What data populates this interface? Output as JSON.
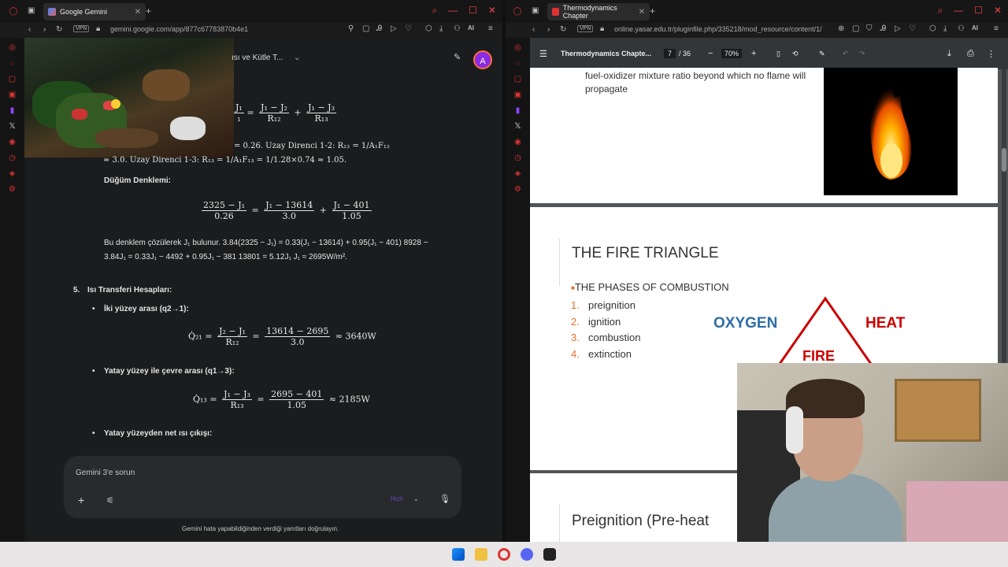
{
  "left_window": {
    "tab_title": "Google Gemini",
    "url": "gemini.google.com/app/877c67783870b4e1",
    "vpn": "VPN",
    "ai_label": "AI",
    "chat_title": "ısı ve Kütle T...",
    "avatar_letter": "A",
    "heading_1": "Düğüm Denklemi:",
    "solve_line": "Bu denklem çözülerek J₁ bulunur. 3.84(2325 − J₁) = 0.33(J₁ − 13614) + 0.95(J₁ − 401) 8928 − 3.84J₁ = 0.33J₁ − 4492 + 0.95J₁ − 381 13801 = 5.12J₁ J₁ ≈ 2695W/m².",
    "section_num": "5.",
    "section_title": "Isı Transferi Hesapları:",
    "bullet_1": "İki yüzey arası (q2→1):",
    "bullet_2": "Yatay yüzey ile çevre arası (q1→3):",
    "bullet_3": "Yatay yüzeyden net ısı çıkışı:",
    "eq_top": "= J₁ − J₂ / R₁₂ + J₁ − J₃ / R₁₃",
    "eq_line2": "= 0.26. Uzay Direnci 1-2: R₁₂ = 1/A₁F₁₂",
    "eq_line3": "≈ 3.0. Uzay Direnci 1-3: R₁₃ = 1/A₁F₁₃ = 1/1.28×0.74 ≈ 1.05.",
    "eq_node_lhs_n": "2325 − J₁",
    "eq_node_lhs_d": "0.26",
    "eq_node_m_n": "J₁ − 13614",
    "eq_node_m_d": "3.0",
    "eq_node_r_n": "J₁ − 401",
    "eq_node_r_d": "1.05",
    "q21_lhs": "Q̇₂₁ =",
    "q21_f1_n": "J₂ − J₁",
    "q21_f1_d": "R₁₂",
    "q21_f2_n": "13614 − 2695",
    "q21_f2_d": "3.0",
    "q21_result": "≈ 3640W",
    "q13_lhs": "Q̇₁₃ =",
    "q13_f1_n": "J₁ − J₃",
    "q13_f1_d": "R₁₃",
    "q13_f2_n": "2695 − 401",
    "q13_f2_d": "1.05",
    "q13_result": "≈ 2185W",
    "input_placeholder": "Gemini 3'e sorun",
    "model_label": "Hızlı",
    "disclaimer": "Gemini hata yapabildiğinden verdiği yanıtları doğrulayın."
  },
  "right_window": {
    "tab_title": "Thermodynamics Chapter",
    "url": "online.yasar.edu.tr/pluginfile.php/335218/mod_resource/content/1/",
    "vpn": "VPN",
    "ai_label": "AI",
    "pdf_title": "Thermodynamics Chapte...",
    "page_current": "7",
    "page_total": "/ 36",
    "zoom": "70%",
    "page_top_text": "fuel-oxidizer mixture ratio beyond which no flame will propagate",
    "slide_title": "THE FIRE TRIANGLE",
    "slide_subtitle": "THE PHASES OF COMBUSTION",
    "phases": [
      {
        "num": "1.",
        "label": "preignition"
      },
      {
        "num": "2.",
        "label": "ignition"
      },
      {
        "num": "3.",
        "label": "combustion"
      },
      {
        "num": "4.",
        "label": "extinction"
      }
    ],
    "triangle_left": "OXYGEN",
    "triangle_right": "HEAT",
    "triangle_bottom": "FIRE",
    "next_slide_title": "Preignition (Pre-heat"
  },
  "colors": {
    "accent_red": "#dd3333",
    "gemini_bg": "#1b1c1d",
    "pdf_bg": "#525659",
    "oxygen_blue": "#2e6da4",
    "fire_red": "#cc0000"
  }
}
